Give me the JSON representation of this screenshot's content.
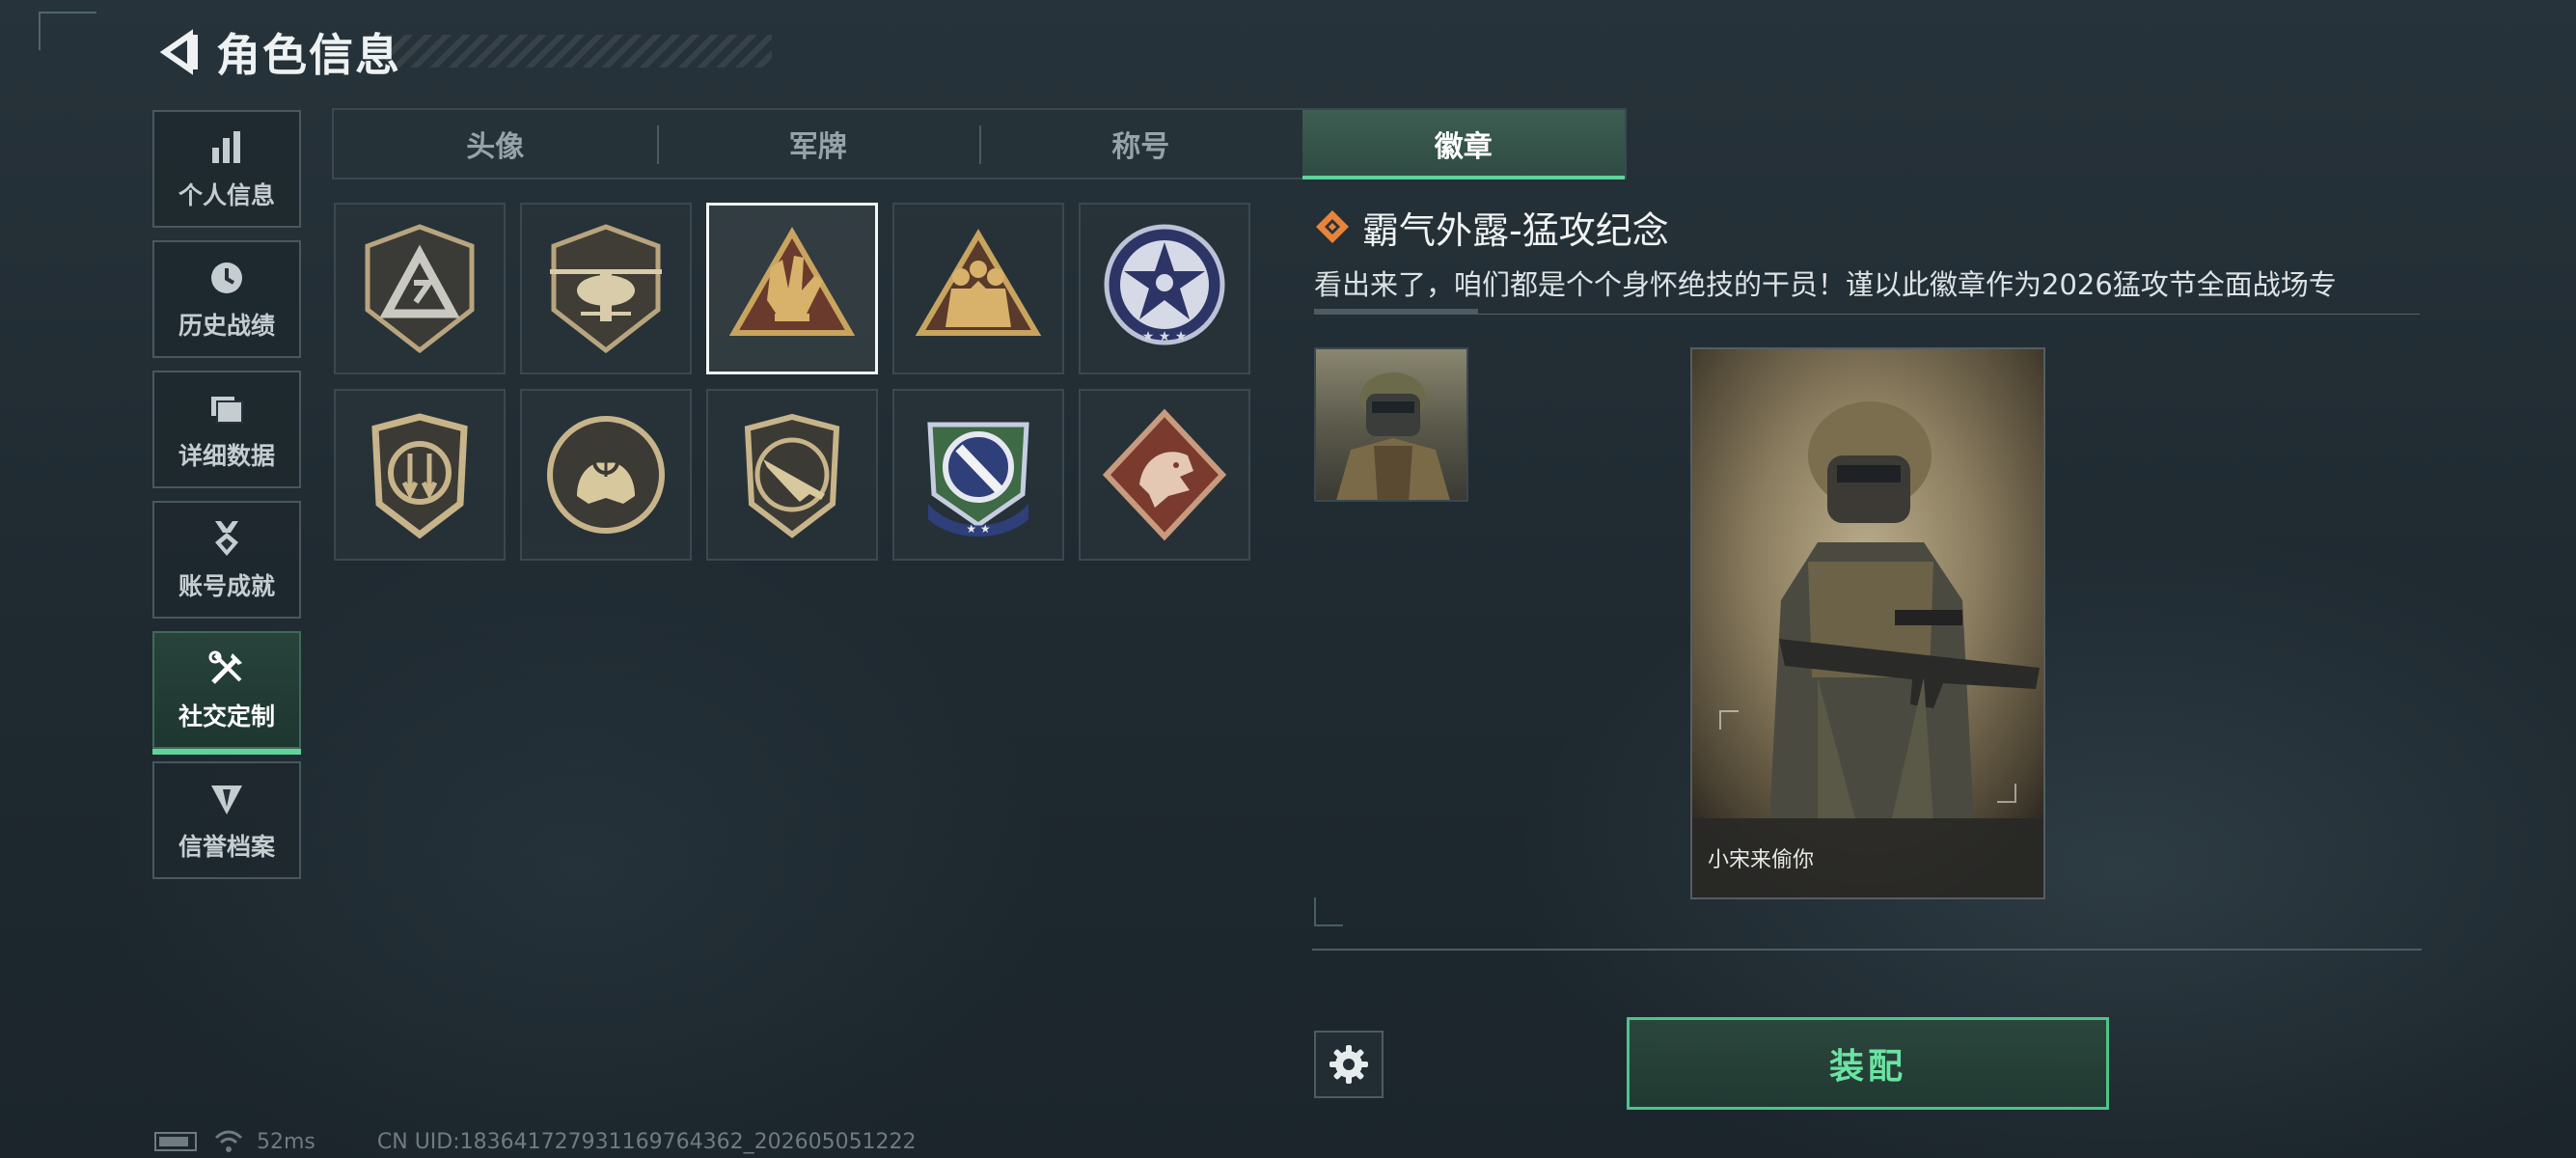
{
  "header": {
    "title": "角色信息"
  },
  "sidebar": {
    "items": [
      {
        "label": "个人信息",
        "icon": "bar-chart-icon",
        "active": false
      },
      {
        "label": "历史战绩",
        "icon": "history-clock-icon",
        "active": false
      },
      {
        "label": "详细数据",
        "icon": "folder-icon",
        "active": false
      },
      {
        "label": "账号成就",
        "icon": "achievement-medal-icon",
        "active": false
      },
      {
        "label": "社交定制",
        "icon": "tools-icon",
        "active": true
      },
      {
        "label": "信誉档案",
        "icon": "reputation-shield-icon",
        "active": false
      }
    ]
  },
  "tabs": [
    {
      "label": "头像",
      "active": false
    },
    {
      "label": "军牌",
      "active": false
    },
    {
      "label": "称号",
      "active": false
    },
    {
      "label": "徽章",
      "active": true
    }
  ],
  "badges": {
    "items": [
      {
        "icon": "triangle-emblem-badge-icon"
      },
      {
        "icon": "helicopter-badge-icon"
      },
      {
        "icon": "hand-gesture-badge-icon",
        "selected": true
      },
      {
        "icon": "squad-soldiers-badge-icon"
      },
      {
        "icon": "star-skull-badge-icon"
      },
      {
        "icon": "down-arrows-shield-badge-icon"
      },
      {
        "icon": "crosshair-skull-badge-icon"
      },
      {
        "icon": "rifle-shield-badge-icon"
      },
      {
        "icon": "knife-target-badge-icon"
      },
      {
        "icon": "dragon-diamond-badge-icon"
      }
    ]
  },
  "detail": {
    "title": "霸气外露-猛攻纪念",
    "description": "看出来了，咱们都是个个身怀绝技的干员！谨以此徽章作为2026猛攻节全面战场专",
    "card_name": "小宋来偷你"
  },
  "actions": {
    "equip_label": "装配",
    "settings_icon": "gear-icon"
  },
  "status_bar": {
    "ping": "52ms",
    "uid": "CN UID:18364172793116976436​2_202605051222"
  },
  "colors": {
    "accent": "#5fd39a",
    "equip_text": "#6be3a3",
    "title_icon": "#e8833a",
    "badge_gold": "#c8b48a"
  }
}
